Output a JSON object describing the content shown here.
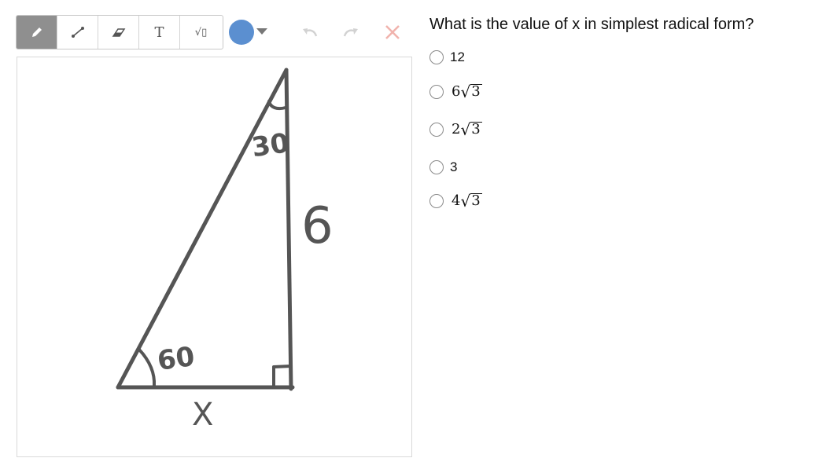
{
  "toolbar": {
    "tools": [
      {
        "name": "pencil",
        "icon": "pencil-icon",
        "active": true
      },
      {
        "name": "line",
        "icon": "line-icon"
      },
      {
        "name": "eraser",
        "icon": "eraser-icon"
      },
      {
        "name": "text",
        "icon": "text-icon",
        "glyph": "T"
      },
      {
        "name": "math",
        "icon": "sqrt-icon",
        "glyph": "√▯"
      }
    ],
    "color": "#5b8fd0",
    "undo_icon": "undo-icon",
    "redo_icon": "redo-icon",
    "clear_icon": "clear-icon"
  },
  "drawing": {
    "labels": [
      "30",
      "6",
      "60",
      "X"
    ]
  },
  "question": {
    "text": "What is the value of x in simplest radical form?",
    "options": [
      {
        "type": "text",
        "text": "12"
      },
      {
        "type": "radical",
        "coef": "6",
        "radicand": "3"
      },
      {
        "type": "radical",
        "coef": "2",
        "radicand": "3"
      },
      {
        "type": "text",
        "text": "3"
      },
      {
        "type": "radical",
        "coef": "4",
        "radicand": "3"
      }
    ]
  }
}
